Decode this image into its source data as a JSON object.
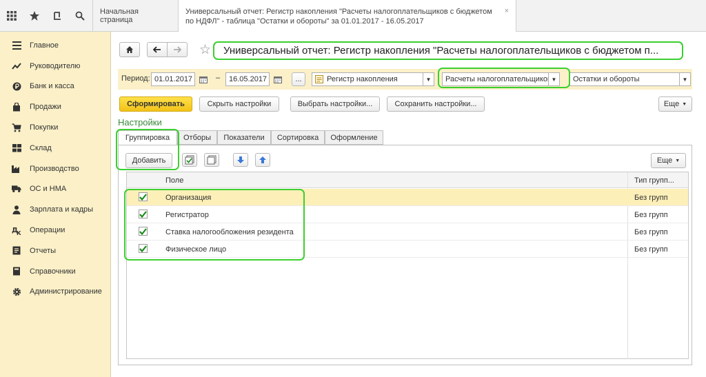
{
  "topbar": {
    "icons": [
      "apps-grid-icon",
      "star-icon",
      "history-icon",
      "search-icon"
    ],
    "tab_home": "Начальная страница",
    "tab_active_line1": "Универсальный отчет: Регистр накопления \"Расчеты налогоплательщиков с бюджетом",
    "tab_active_line2": "по НДФЛ\" - таблица \"Остатки и обороты\" за 01.01.2017 - 16.05.2017",
    "tab_close": "×"
  },
  "sidebar": {
    "items": [
      {
        "label": "Главное",
        "icon": "menu-lines-icon"
      },
      {
        "label": "Руководителю",
        "icon": "trend-icon"
      },
      {
        "label": "Банк и касса",
        "icon": "ruble-coin-icon"
      },
      {
        "label": "Продажи",
        "icon": "bag-icon"
      },
      {
        "label": "Покупки",
        "icon": "cart-icon"
      },
      {
        "label": "Склад",
        "icon": "warehouse-icon"
      },
      {
        "label": "Производство",
        "icon": "factory-icon"
      },
      {
        "label": "ОС и НМА",
        "icon": "truck-icon"
      },
      {
        "label": "Зарплата и кадры",
        "icon": "person-icon"
      },
      {
        "label": "Операции",
        "icon": "operations-icon"
      },
      {
        "label": "Отчеты",
        "icon": "report-icon"
      },
      {
        "label": "Справочники",
        "icon": "book-icon"
      },
      {
        "label": "Администрирование",
        "icon": "gear-icon"
      }
    ]
  },
  "header": {
    "title": "Универсальный отчет: Регистр накопления \"Расчеты налогоплательщиков с бюджетом п..."
  },
  "period": {
    "label": "Период:",
    "from": "01.01.2017",
    "dash": "–",
    "to": "16.05.2017",
    "more": "...",
    "source_type": "Регистр накопления",
    "source": "Расчеты налогоплательщиков",
    "table": "Остатки и обороты"
  },
  "actions": {
    "generate": "Сформировать",
    "hide_settings": "Скрыть настройки",
    "choose_settings": "Выбрать настройки...",
    "save_settings": "Сохранить настройки...",
    "more": "Еще"
  },
  "settings": {
    "label": "Настройки",
    "tabs": [
      "Группировка",
      "Отборы",
      "Показатели",
      "Сортировка",
      "Оформление"
    ],
    "add": "Добавить",
    "more": "Еще",
    "grid": {
      "col_field": "Поле",
      "col_type": "Тип групп...",
      "rows": [
        {
          "field": "Организация",
          "type": "Без групп",
          "checked": true
        },
        {
          "field": "Регистратор",
          "type": "Без групп",
          "checked": true
        },
        {
          "field": "Ставка налогообложения резидента",
          "type": "Без групп",
          "checked": true
        },
        {
          "field": "Физическое лицо",
          "type": "Без групп",
          "checked": true
        }
      ]
    }
  },
  "colors": {
    "accent_green": "#3ccf2f",
    "sidebar_bg": "#fbf0c8",
    "generate_btn": "#f5cc1e"
  }
}
